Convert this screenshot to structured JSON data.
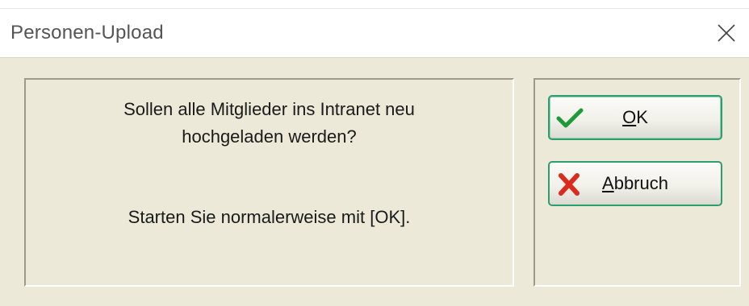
{
  "window": {
    "title": "Personen-Upload"
  },
  "message": {
    "line1": "Sollen alle Mitglieder ins Intranet neu",
    "line2": "hochgeladen werden?",
    "line3": "Starten Sie normalerweise mit [OK]."
  },
  "buttons": {
    "ok": {
      "mnemonic": "O",
      "rest": "K",
      "icon": "checkmark-icon"
    },
    "cancel": {
      "mnemonic": "A",
      "rest": "bbruch",
      "icon": "cross-icon"
    }
  },
  "colors": {
    "dialog_bg": "#ece9d8",
    "button_border": "#2f9e6f",
    "check_green": "#1f9a3a",
    "cross_red": "#d92b1f"
  }
}
